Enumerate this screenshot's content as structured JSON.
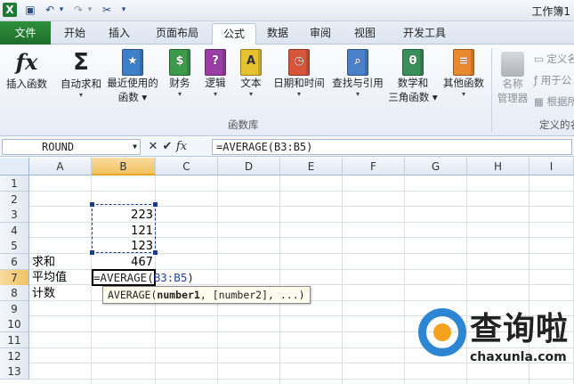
{
  "window": {
    "title": "工作簿1"
  },
  "quick_access": [
    {
      "name": "excel-logo-icon",
      "glyph": "X"
    },
    {
      "name": "save-icon",
      "glyph": "💾"
    },
    {
      "name": "undo-icon",
      "glyph": "↶"
    },
    {
      "name": "undo-dropdown-icon",
      "glyph": "▾"
    },
    {
      "name": "redo-icon",
      "glyph": "↷"
    },
    {
      "name": "redo-dropdown-icon",
      "glyph": "▾"
    },
    {
      "name": "tools-icon",
      "glyph": "✂"
    },
    {
      "name": "customize-qat-icon",
      "glyph": "▾"
    }
  ],
  "tabs": {
    "file": "文件",
    "items": [
      "开始",
      "插入",
      "页面布局",
      "公式",
      "数据",
      "审阅",
      "视图",
      "开发工具"
    ],
    "active": "公式"
  },
  "ribbon": {
    "insert_function": "插入函数",
    "autosum": "自动求和",
    "recent_line1": "最近使用的",
    "recent_line2": "函数",
    "financial": "财务",
    "logical": "逻辑",
    "text": "文本",
    "datetime": "日期和时间",
    "lookup": "查找与引用",
    "math_line1": "数学和",
    "math_line2": "三角函数",
    "more": "其他函数",
    "group_label": "函数库",
    "name_manager_line1": "名称",
    "name_manager_line2": "管理器",
    "define_name": "定义名",
    "use_in_formula": "用于公",
    "create_from_selection": "根据所",
    "defined_names_group": "定义的名"
  },
  "icons": {
    "financial": {
      "color": "#3d9a4a",
      "glyph": "$"
    },
    "logical": {
      "color": "#9a3ea6",
      "glyph": "?"
    },
    "text": {
      "color": "#e6c22f",
      "glyph": "A"
    },
    "datetime": {
      "color": "#d8553a",
      "glyph": "◷"
    },
    "lookup": {
      "color": "#4a7fc9",
      "glyph": "⌕"
    },
    "math": {
      "color": "#3b8f5a",
      "glyph": "θ"
    },
    "more": {
      "color": "#e88a2d",
      "glyph": "≡"
    },
    "recent": {
      "color": "#3d7fc9",
      "glyph": "★"
    }
  },
  "formula_bar": {
    "name_box": "ROUND",
    "cancel": "✕",
    "enter": "✔",
    "fx": "fx",
    "formula": "=AVERAGE(B3:B5)"
  },
  "sheet": {
    "columns": [
      "A",
      "B",
      "C",
      "D",
      "E",
      "F",
      "G",
      "H",
      "I"
    ],
    "rows": [
      "1",
      "2",
      "3",
      "4",
      "5",
      "6",
      "7",
      "8",
      "9",
      "10",
      "11",
      "12",
      "13"
    ],
    "cells": {
      "B3": "223",
      "B4": "121",
      "B5": "123",
      "A6": "求和",
      "B6": "467",
      "A7": "平均值",
      "A8": "计数"
    },
    "editing_prefix": "=AVERAGE(",
    "editing_ref": "B3:B5",
    "editing_suffix": ")",
    "tooltip_func": "AVERAGE(",
    "tooltip_arg1": "number1",
    "tooltip_rest": ", [number2], ...)"
  },
  "watermark": {
    "brand": "查询啦",
    "domain": "chaxunla.com"
  }
}
